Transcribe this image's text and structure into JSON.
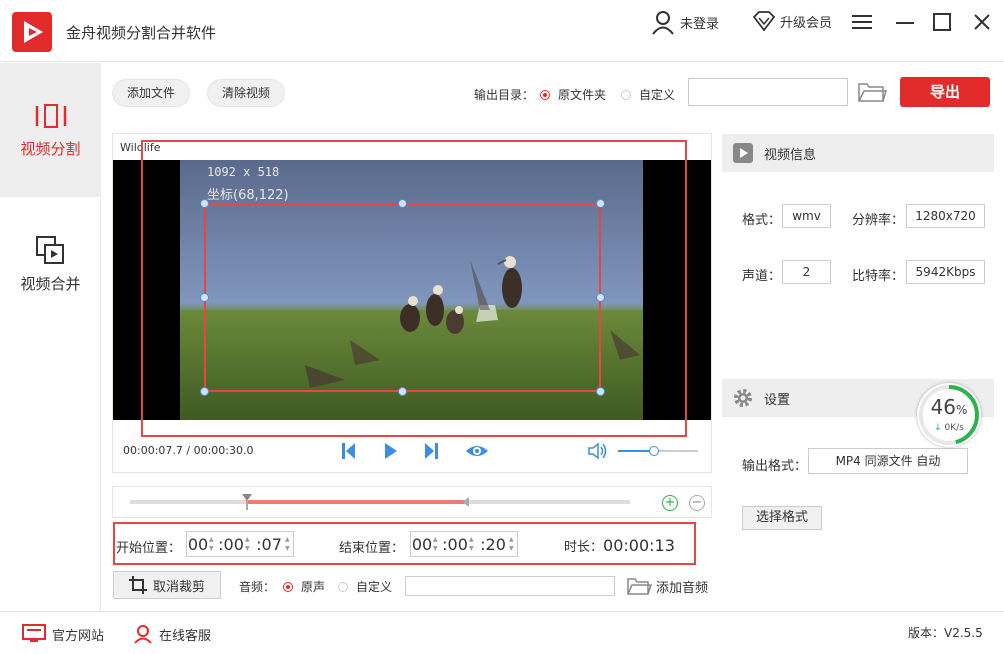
{
  "app": {
    "title": "金舟视频分割合并软件"
  },
  "header": {
    "login": "未登录",
    "vip": "升级会员"
  },
  "sidebar": {
    "items": [
      {
        "label": "视频分割"
      },
      {
        "label": "视频合并"
      }
    ]
  },
  "toolbar": {
    "add_file": "添加文件",
    "clear_video": "清除视频",
    "output_dir_label": "输出目录：",
    "output_original": "原文件夹",
    "output_custom": "自定义",
    "output_path": "",
    "export": "导出"
  },
  "video": {
    "name": "Wildlife",
    "dimensions": "1092 x 518",
    "coord": "坐标(68,122)",
    "time": "00:00:07.7 / 00:00:30.0",
    "volume": 0.45
  },
  "timeline": {
    "start_fraction": 0.233,
    "end_fraction": 0.667,
    "zoom_in": "+",
    "zoom_out": "−"
  },
  "trim": {
    "start_label": "开始位置：",
    "start": {
      "h": "00",
      "m": ":00",
      "s": ":07"
    },
    "end_label": "结束位置：",
    "end": {
      "h": "00",
      "m": ":00",
      "s": ":20"
    },
    "duration_label": "时长：",
    "duration": "00:00:13",
    "cancel_crop": "取消裁剪"
  },
  "audio": {
    "label": "音频：",
    "original": "原声",
    "custom": "自定义",
    "path": "",
    "add": "添加音频"
  },
  "info": {
    "title": "视频信息",
    "format_label": "格式：",
    "format": "wmv",
    "resolution_label": "分辨率：",
    "resolution": "1280x720",
    "channels_label": "声道：",
    "channels": "2",
    "bitrate_label": "比特率：",
    "bitrate": "5942Kbps"
  },
  "settings": {
    "title": "设置",
    "output_format_label": "输出格式：",
    "output_format": "MP4 同源文件 自动",
    "choose_format": "选择格式"
  },
  "speed": {
    "percent": "46",
    "percent_sign": "%",
    "rate": "0K/s",
    "progress": 0.46
  },
  "footer": {
    "website": "官方网站",
    "support": "在线客服",
    "version": "版本：V2.5.5"
  },
  "colors": {
    "accent": "#e22b2b",
    "crop": "#e84545",
    "green": "#2ab44a",
    "blue": "#3a8ee6"
  }
}
